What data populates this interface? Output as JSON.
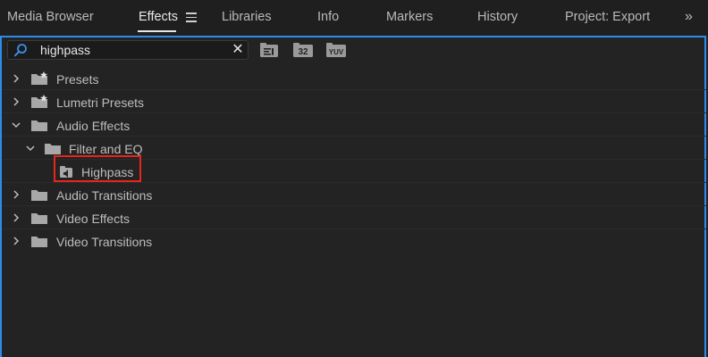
{
  "tabs": [
    {
      "label": "Media Browser",
      "active": false
    },
    {
      "label": "Effects",
      "active": true
    },
    {
      "label": "Libraries",
      "active": false
    },
    {
      "label": "Info",
      "active": false
    },
    {
      "label": "Markers",
      "active": false
    },
    {
      "label": "History",
      "active": false
    },
    {
      "label": "Project: Export",
      "active": false
    }
  ],
  "tab_menu_icon": "hamburger-menu-icon",
  "overflow_icon": "chevron-double-right-icon",
  "search": {
    "value": "highpass",
    "icon": "search-icon",
    "clear_icon": "close-icon"
  },
  "toolbar": {
    "buttons": [
      {
        "name": "accelerated-effects-filter",
        "icon": "accelerated-effects-icon"
      },
      {
        "name": "32-bit-color-filter",
        "icon": "32-bit-icon",
        "label": "32"
      },
      {
        "name": "yuv-effects-filter",
        "icon": "yuv-icon",
        "label": "YUV"
      }
    ]
  },
  "tree": [
    {
      "label": "Presets",
      "icon": "star-folder-icon",
      "expanded": false,
      "depth": 0
    },
    {
      "label": "Lumetri Presets",
      "icon": "star-folder-icon",
      "expanded": false,
      "depth": 0
    },
    {
      "label": "Audio Effects",
      "icon": "folder-icon",
      "expanded": true,
      "depth": 0
    },
    {
      "label": "Filter and EQ",
      "icon": "folder-icon",
      "expanded": true,
      "depth": 1
    },
    {
      "label": "Highpass",
      "icon": "audio-effect-icon",
      "expanded": null,
      "depth": 2,
      "highlighted": true
    },
    {
      "label": "Audio Transitions",
      "icon": "folder-icon",
      "expanded": false,
      "depth": 0
    },
    {
      "label": "Video Effects",
      "icon": "folder-icon",
      "expanded": false,
      "depth": 0
    },
    {
      "label": "Video Transitions",
      "icon": "folder-icon",
      "expanded": false,
      "depth": 0
    }
  ],
  "colors": {
    "focus_frame": "#2d8ceb",
    "highlight": "#e8251c",
    "panel_bg": "#232323"
  }
}
